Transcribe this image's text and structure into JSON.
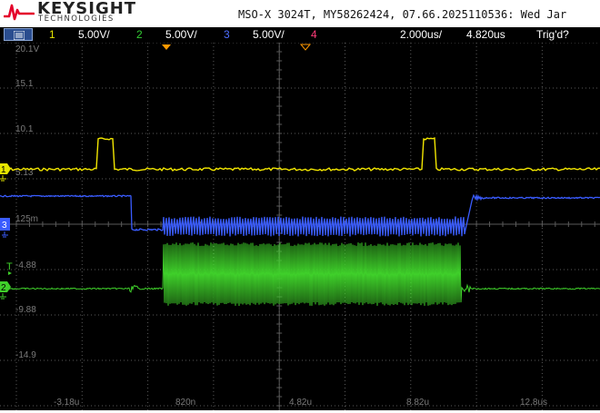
{
  "header": {
    "brand": "KEYSIGHT",
    "brand_sub": "TECHNOLOGIES",
    "instrument": "MSO-X 3024T, MY58262424, 07.66.2025110536: Wed Jar"
  },
  "statusbar": {
    "channels": [
      {
        "num": "1",
        "scale": "5.00V/",
        "color": "#e6e600"
      },
      {
        "num": "2",
        "scale": "5.00V/",
        "color": "#33cc33"
      },
      {
        "num": "3",
        "scale": "5.00V/",
        "color": "#4d6dff"
      },
      {
        "num": "4",
        "scale": "",
        "color": "#ff3b7a"
      }
    ],
    "timebase": "2.000us/",
    "delay": "4.820us",
    "trigger_status": "Trig'd?"
  },
  "display": {
    "y_labels": [
      "20.1V",
      "15.1",
      "10.1",
      "5.13",
      "125m",
      "-4.88",
      "-9.88",
      "-14.9"
    ],
    "x_labels": [
      "-3.18u",
      "820n",
      "4.82u",
      "8.82u",
      "12.8us"
    ],
    "channel_markers": [
      "1",
      "3",
      "2"
    ],
    "trigger_marker": "T",
    "colors": {
      "ch1": "#f2e600",
      "ch2": "#3fcf2a",
      "ch3": "#3a5cff",
      "grid": "#5a5a5a",
      "label": "#7a7a7a"
    }
  }
}
